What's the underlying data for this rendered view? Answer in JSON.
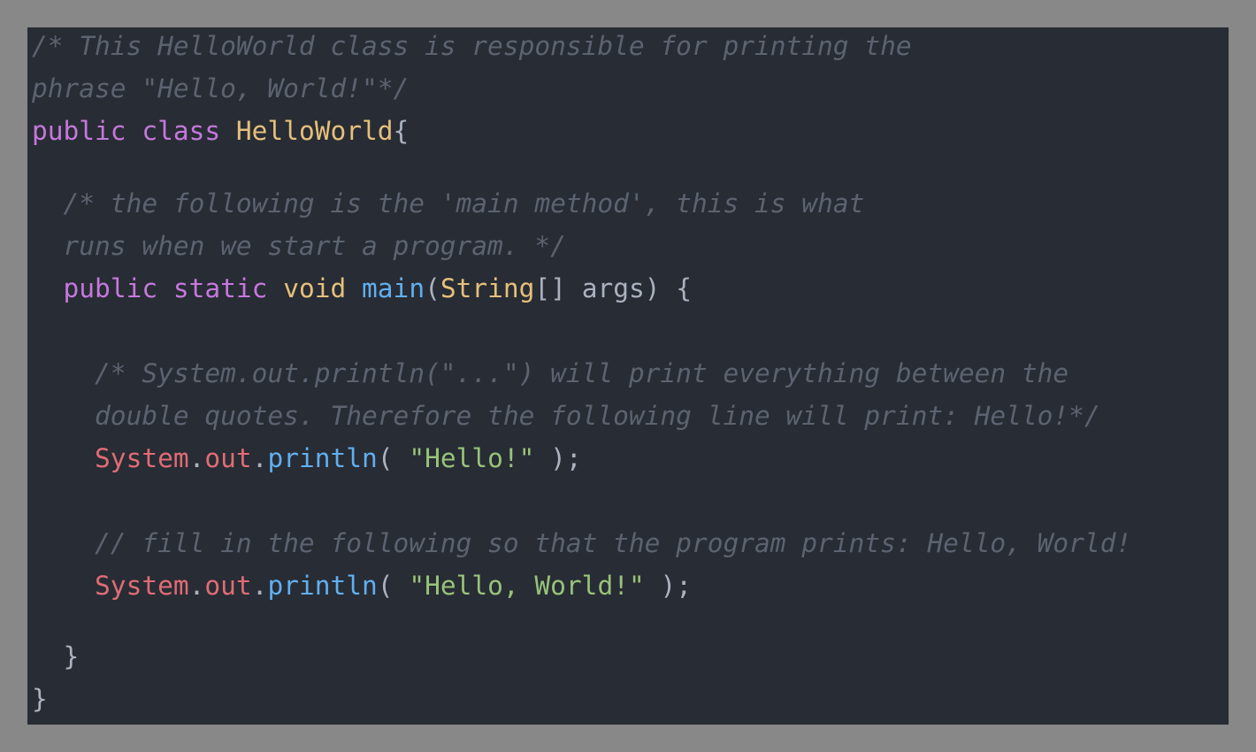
{
  "code": {
    "line_1": "/* This HelloWorld class is responsible for printing the",
    "line_2": "phrase \"Hello, World!\"*/",
    "line_3": {
      "kw_public": "public",
      "kw_class": "class",
      "class_name": "HelloWorld",
      "brace": "{"
    },
    "line_5": "  /* the following is the 'main method', this is what",
    "line_6": "  runs when we start a program. */",
    "line_7": {
      "indent": "  ",
      "kw_public": "public",
      "kw_static": "static",
      "kw_void": "void",
      "method": "main",
      "paren_open": "(",
      "param_type": "String",
      "rest": "[] args) {"
    },
    "line_9": "    /* System.out.println(\"...\") will print everything between the",
    "line_10": "    double quotes. Therefore the following line will print: Hello!*/",
    "line_11": {
      "indent": "    ",
      "obj": "System",
      "dot1": ".",
      "field": "out",
      "dot2": ".",
      "method": "println",
      "open": "( ",
      "string": "\"Hello!\"",
      "close": " );"
    },
    "line_13": "    // fill in the following so that the program prints: Hello, World!",
    "line_14": {
      "indent": "    ",
      "obj": "System",
      "dot1": ".",
      "field": "out",
      "dot2": ".",
      "method": "println",
      "open": "( ",
      "string": "\"Hello, World!\"",
      "close": " );"
    },
    "line_16": "  }",
    "line_17": "}"
  },
  "colors": {
    "background": "#282c34",
    "frame": "#888888",
    "comment": "#5c6370",
    "keyword": "#c678dd",
    "type": "#e5c07b",
    "function": "#61afef",
    "object": "#e06c75",
    "string": "#98c379",
    "text": "#abb2bf"
  }
}
